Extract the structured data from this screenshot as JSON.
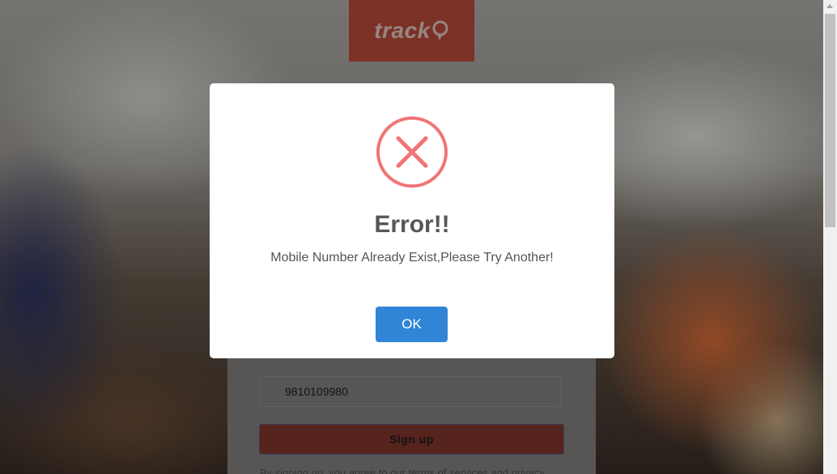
{
  "logo": {
    "text": "track",
    "pin_icon": "map-pin-icon",
    "color": "#c9503f"
  },
  "signup_form": {
    "phone_value": "9810109980",
    "signup_label": "Sign up",
    "terms_text": "By signing up, you agree to our terms of services and privacy"
  },
  "modal": {
    "icon": "error-x-icon",
    "title": "Error!!",
    "message": "Mobile Number Already Exist,Please Try Another!",
    "ok_label": "OK",
    "ok_color": "#3085d6",
    "icon_color": "#f27474"
  }
}
